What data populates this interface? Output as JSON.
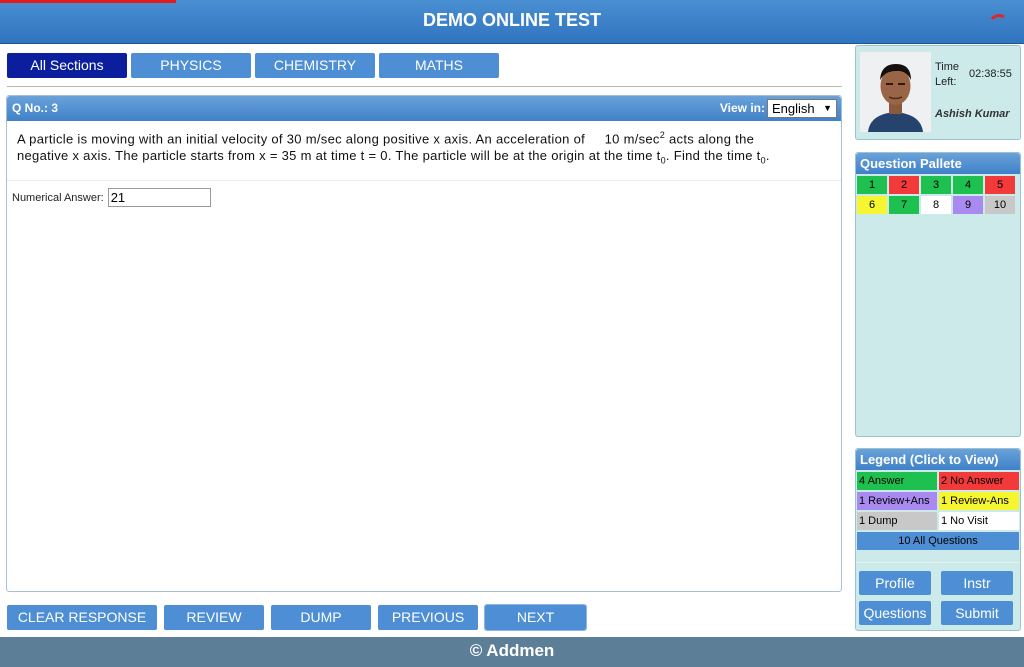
{
  "header": {
    "title": "DEMO ONLINE TEST"
  },
  "sections": [
    {
      "label": "All Sections",
      "active": true
    },
    {
      "label": "PHYSICS",
      "active": false
    },
    {
      "label": "CHEMISTRY",
      "active": false
    },
    {
      "label": "MATHS",
      "active": false
    }
  ],
  "question": {
    "number_label": "Q No.: 3",
    "view_in_label": "View in:",
    "language": "English",
    "text": {
      "part1": "A particle is moving with an initial velocity of 30 m/sec along positive x axis. An acceleration of",
      "accel_value": "10 m/sec",
      "accel_exp": "2",
      "part2": "acts along the negative x axis. The particle starts from x = 35 m at time t = 0. The particle will be at the origin",
      "part3_a": "at the time t",
      "sub1": "0",
      "part3_b": ". Find the time t",
      "sub2": "0",
      "part3_c": "."
    },
    "answer_label": "Numerical Answer:",
    "answer_value": "21"
  },
  "actions": {
    "clear": "CLEAR RESPONSE",
    "review": "REVIEW",
    "dump": "DUMP",
    "previous": "PREVIOUS",
    "next": "NEXT"
  },
  "profile": {
    "time_label": "Time Left:",
    "time_value": "02:38:55",
    "name": "Ashish Kumar"
  },
  "pallete": {
    "title": "Question Pallete",
    "items": [
      {
        "n": "1",
        "color": "#1ec050"
      },
      {
        "n": "2",
        "color": "#f23a3a"
      },
      {
        "n": "3",
        "color": "#1ec050"
      },
      {
        "n": "4",
        "color": "#1ec050"
      },
      {
        "n": "5",
        "color": "#f23a3a"
      },
      {
        "n": "6",
        "color": "#f5f530"
      },
      {
        "n": "7",
        "color": "#1ec050"
      },
      {
        "n": "8",
        "color": "#ffffff"
      },
      {
        "n": "9",
        "color": "#a98af0"
      },
      {
        "n": "10",
        "color": "#c8c8c8"
      }
    ]
  },
  "legend": {
    "title": "Legend (Click to View)",
    "items": [
      {
        "label": "4 Answer",
        "color": "#1ec050"
      },
      {
        "label": "2 No Answer",
        "color": "#f23a3a"
      },
      {
        "label": "1 Review+Ans",
        "color": "#a98af0"
      },
      {
        "label": "1 Review-Ans",
        "color": "#f5f530"
      },
      {
        "label": "1 Dump",
        "color": "#c8c8c8"
      },
      {
        "label": "1 No Visit",
        "color": "#ffffff"
      }
    ],
    "all": "10 All Questions"
  },
  "side_buttons": {
    "profile": "Profile",
    "instr": "Instr",
    "questions": "Questions",
    "submit": "Submit"
  },
  "footer": {
    "text": "© Addmen"
  }
}
